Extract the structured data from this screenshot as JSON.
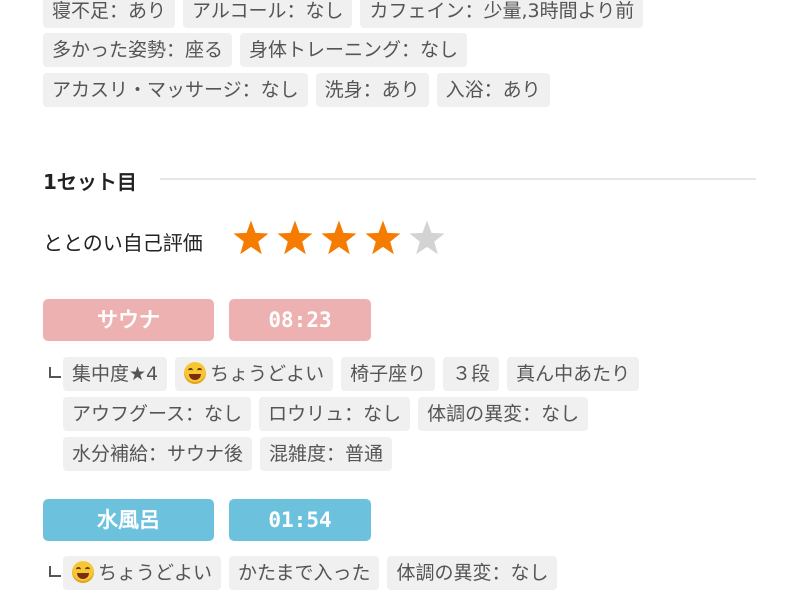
{
  "top_tags": [
    [
      "寝不足：あり",
      "アルコール：なし",
      "カフェイン：少量,3時間より前"
    ],
    [
      "多かった姿勢：座る",
      "身体トレーニング：なし"
    ],
    [
      "アカスリ・マッサージ：なし",
      "洗身：あり",
      "入浴：あり"
    ]
  ],
  "set": {
    "title": "1セット目",
    "rating_label": "ととのい自己評価",
    "rating": 4,
    "rating_max": 5,
    "sauna": {
      "label": "サウナ",
      "time": "08:23",
      "tags": [
        [
          "集中度★4",
          "ちょうどよい",
          "椅子座り",
          "３段",
          "真ん中あたり"
        ],
        [
          "アウフグース：なし",
          "ロウリュ：なし",
          "体調の異変：なし"
        ],
        [
          "水分補給：サウナ後",
          "混雑度：普通"
        ]
      ]
    },
    "water": {
      "label": "水風呂",
      "time": "01:54",
      "tags": [
        [
          "ちょうどよい",
          "かたまで入った",
          "体調の異変：なし"
        ]
      ]
    }
  },
  "colors": {
    "sauna": "#eeb1b1",
    "water": "#6cc1dc",
    "star_on": "#f57c00",
    "star_off": "#d3d3d3",
    "tag_bg": "#f0f0f0"
  }
}
